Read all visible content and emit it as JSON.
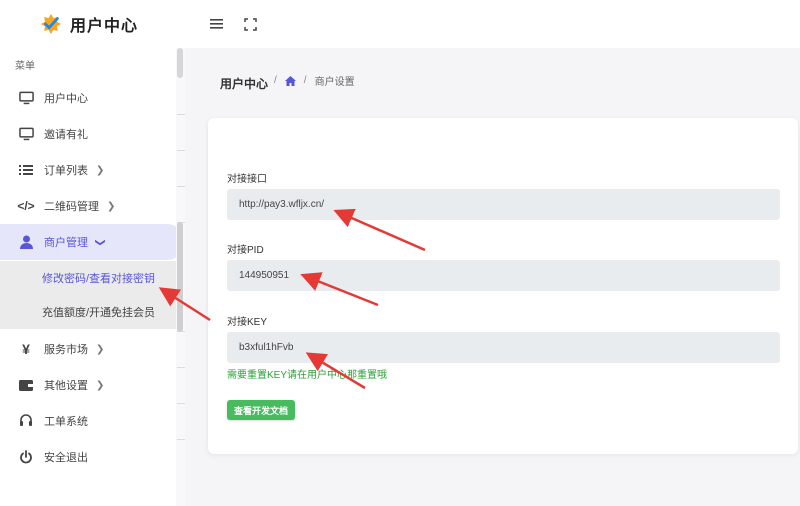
{
  "brand": {
    "name": "用户中心"
  },
  "sidebar": {
    "caption": "菜单",
    "items": [
      {
        "label": "用户中心",
        "icon": "monitor-icon"
      },
      {
        "label": "邀请有礼",
        "icon": "monitor-icon"
      },
      {
        "label": "订单列表",
        "icon": "list-icon"
      },
      {
        "label": "二维码管理",
        "icon": "code-icon"
      },
      {
        "label": "商户管理",
        "icon": "user-icon"
      },
      {
        "label": "服务市场",
        "icon": "yen-icon"
      },
      {
        "label": "其他设置",
        "icon": "wallet-icon"
      },
      {
        "label": "工单系统",
        "icon": "headset-icon"
      },
      {
        "label": "安全退出",
        "icon": "power-icon"
      }
    ],
    "submenu": [
      {
        "label": "修改密码/查看对接密钥"
      },
      {
        "label": "充值额度/开通免挂会员"
      }
    ]
  },
  "breadcrumb": {
    "title": "用户中心",
    "current": "商户设置"
  },
  "form": {
    "fields": [
      {
        "label": "对接接口",
        "value": "http://pay3.wfljx.cn/"
      },
      {
        "label": "对接PID",
        "value": "144950951"
      },
      {
        "label": "对接KEY",
        "value": "b3xful1hFvb"
      }
    ],
    "hint": "需要重置KEY请在用户中心那重置哦",
    "doc_button": "查看开发文档"
  },
  "colors": {
    "accent": "#5856d6",
    "success": "#48bb5f",
    "arrow": "#e53935"
  }
}
